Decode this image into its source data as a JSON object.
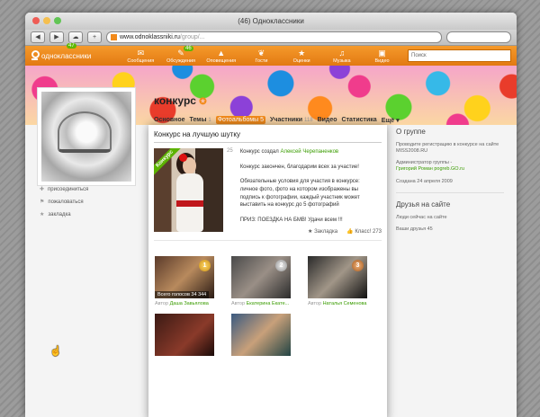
{
  "window": {
    "title": "(46) Одноклассники",
    "url_host": "www.odnoklassniki.ru",
    "url_path": "/group/..."
  },
  "topnav": {
    "logo_text": "одноклассники",
    "logo_badge": "47",
    "items": [
      {
        "label": "Сообщения",
        "icon": "envelope-icon",
        "badge": ""
      },
      {
        "label": "Обсуждения",
        "icon": "chat-icon",
        "badge": "46"
      },
      {
        "label": "Оповещения",
        "icon": "bell-icon",
        "badge": ""
      },
      {
        "label": "Гости",
        "icon": "footprints-icon",
        "badge": ""
      },
      {
        "label": "Оценки",
        "icon": "star-icon",
        "badge": ""
      },
      {
        "label": "Музыка",
        "icon": "music-icon",
        "badge": ""
      },
      {
        "label": "Видео",
        "icon": "video-icon",
        "badge": ""
      }
    ],
    "search_placeholder": "Поиск"
  },
  "sidebar": {
    "links": [
      {
        "label": "присоединиться",
        "icon": "plus-icon"
      },
      {
        "label": "пожаловаться",
        "icon": "flag-icon"
      },
      {
        "label": "закладка",
        "icon": "star-icon"
      }
    ]
  },
  "group": {
    "name": "конкурс",
    "tabs": [
      {
        "label": "Основное",
        "count": ""
      },
      {
        "label": "Темы",
        "count": "1"
      },
      {
        "label": "Фотоальбомы",
        "count": "5"
      },
      {
        "label": "Участники",
        "count": "118"
      },
      {
        "label": "Видео",
        "count": ""
      },
      {
        "label": "Статистика",
        "count": ""
      },
      {
        "label": "Ещё ▾",
        "count": ""
      }
    ]
  },
  "modal": {
    "title": "Конкурс на лучшую шутку",
    "ribbon": "Конкурс",
    "photo_number": "25",
    "created_prefix": "Конкурс создал",
    "created_by": "Алексей Черепаненков",
    "finished": "Конкурс закончен, благодарим всех за участие!",
    "conditions": "Обязательные условия для участия в конкурсе: личное фото, фото на котором изображены вы подпись к фотографии, каждый участник может выставить на конкурс до 5 фотографий",
    "prize": "ПРИЗ: ПОЕЗДКА НА БМВ! Удачи всем !!!",
    "bookmark": "Закладка",
    "class_label": "Класс!",
    "class_count": "273",
    "entries": [
      {
        "votes": "Всего голосов 34 344",
        "author_prefix": "Автор",
        "author": "Даша Завьялова",
        "medal": "1"
      },
      {
        "votes": "",
        "author_prefix": "Автор",
        "author": "Екатерина Екате...",
        "medal": "2"
      },
      {
        "votes": "",
        "author_prefix": "Автор",
        "author": "Наталья Семенова",
        "medal": "3"
      },
      {
        "votes": "",
        "author_prefix": "",
        "author": "",
        "medal": ""
      },
      {
        "votes": "",
        "author_prefix": "",
        "author": "",
        "medal": ""
      }
    ]
  },
  "about": {
    "title": "О группе",
    "text": "Проводите регистрацию в конкурсе на сайте MISS2008.RU",
    "admin_label": "Администратор группы -",
    "admin_name": "Григорий Роман pogreb.GO.ru",
    "created": "Создана 24 апреля 2009",
    "friends_title": "Друзья на сайте",
    "friends_now": "Люди сейчас на сайте",
    "friends_all": "Ваши друзья 45"
  },
  "colors": {
    "accent": "#f28a1a",
    "link_green": "#3a9c00"
  }
}
